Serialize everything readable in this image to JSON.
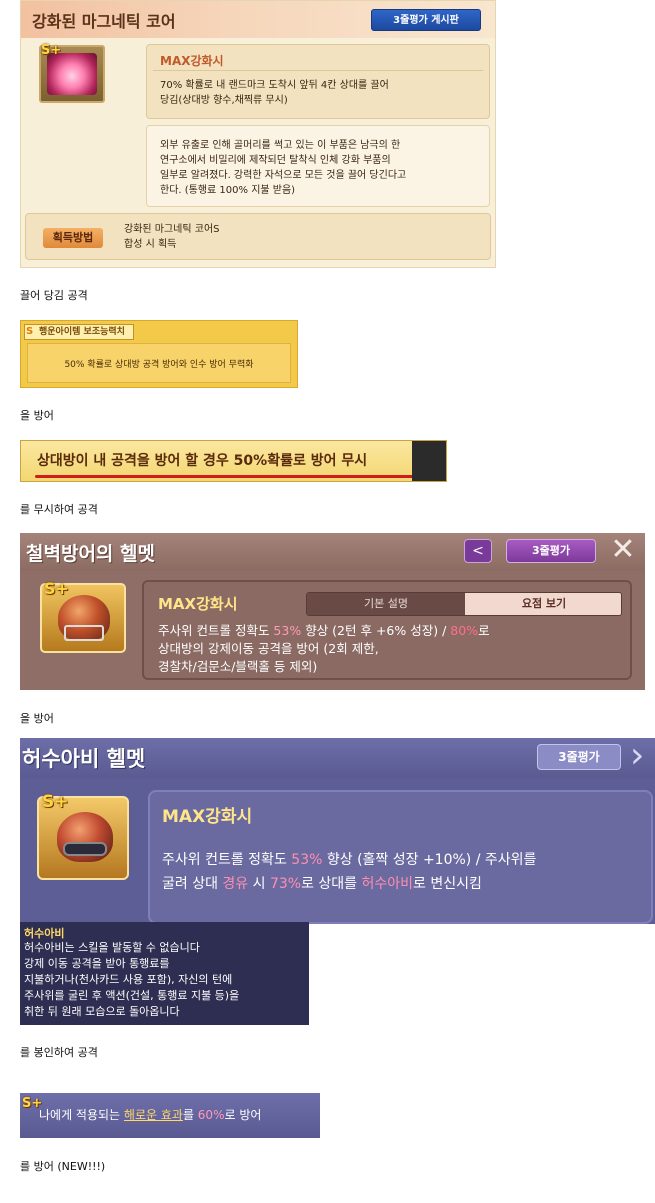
{
  "panel1": {
    "title": "강화된 마그네틱 코어",
    "rate_button": "3줄평가 게시판",
    "max_label": "MAX강화시",
    "effect_line1": "70% 확률로 내 랜드마크 도착시 앞뒤 4칸 상대를 끌어",
    "effect_line2": "당김(상대방 향수,채찍류 무시)",
    "lore_line1": "외부 유출로 인해 골머리를 썩고 있는 이 부품은 남극의 한",
    "lore_line2": "연구소에서 비밀리에 제작되던 탈착식 인체 강화 부품의",
    "lore_line3": "일부로 알려졌다. 강력한 자석으로 모든 것을 끌어 당긴다고",
    "lore_line4": "한다. (통행료 100% 지불 받음)",
    "acquire_label": "획득방법",
    "acquire_line1": "강화된 마그네틱 코어S",
    "acquire_line2": "합성 시 획득"
  },
  "caption1": "끌어 당김 공격",
  "panel2": {
    "tag": "행운아이템 보조능력치",
    "text": "50% 확률로 상대방 공격 방어와 인수 방어 무력화"
  },
  "caption2": "을 방어",
  "panel3": {
    "text": "상대방이 내 공격을 방어 할 경우 50%확률로 방어 무시"
  },
  "caption3": "를 무시하여 공격",
  "panel4": {
    "title": "철벽방어의 헬멧",
    "share_icon": "share-icon",
    "rate_button": "3줄평가",
    "max_label": "MAX강화시",
    "tab_basic": "기본 설명",
    "tab_summary": "요점 보기",
    "desc_a": "주사위 컨트롤 정확도 ",
    "desc_b": "53%",
    "desc_c": " 향상 (2턴 후 +6% 성장) / ",
    "desc_d": "80%",
    "desc_e": "로",
    "desc_line2": "상대방의 강제이동 공격을 방어 (2회 제한,",
    "desc_line3": "경찰차/검문소/블랙홀 등 제외)"
  },
  "caption4": "을 방어",
  "panel5": {
    "title": "허수아비 헬멧",
    "rate_button": "3줄평가",
    "max_label": "MAX강화시",
    "l1_a": "주사위 컨트롤 정확도 ",
    "l1_b": "53%",
    "l1_c": " 향상 (홀짝 성장 +10%) / 주사위를",
    "l2_a": "굴려 상대 ",
    "l2_b": "경유",
    "l2_c": " 시 ",
    "l2_d": "73%",
    "l2_e": "로 상대를 ",
    "l2_f": "허수아비",
    "l2_g": "로 변신시킴"
  },
  "tooltip": {
    "title": "허수아비",
    "line1": "허수아비는 스킬을 발동할 수 없습니다",
    "line2": "강제 이동 공격을 받아 통행료를",
    "line3": "지불하거나(천사카드 사용 포함), 자신의 턴에",
    "line4": "주사위를 굴린 후 액션(건설, 통행료 지불 등)을",
    "line5": "취한 뒤 원래 모습으로 돌아옵니다"
  },
  "caption5": "를 봉인하여 공격",
  "panel6": {
    "a": "나에게 적용되는 ",
    "b": "해로운 효과",
    "c": "를 ",
    "d": "60%",
    "e": "로 방어"
  },
  "caption6": "를 방어 (NEW!!!)",
  "colors": {
    "panel1_bg": "#f8efd9",
    "panel4_bg": "#8e6e66",
    "panel5_bg": "#5e5e96",
    "highlight_pink": "#ff9ab6",
    "underline_red": "#d21b1b"
  }
}
